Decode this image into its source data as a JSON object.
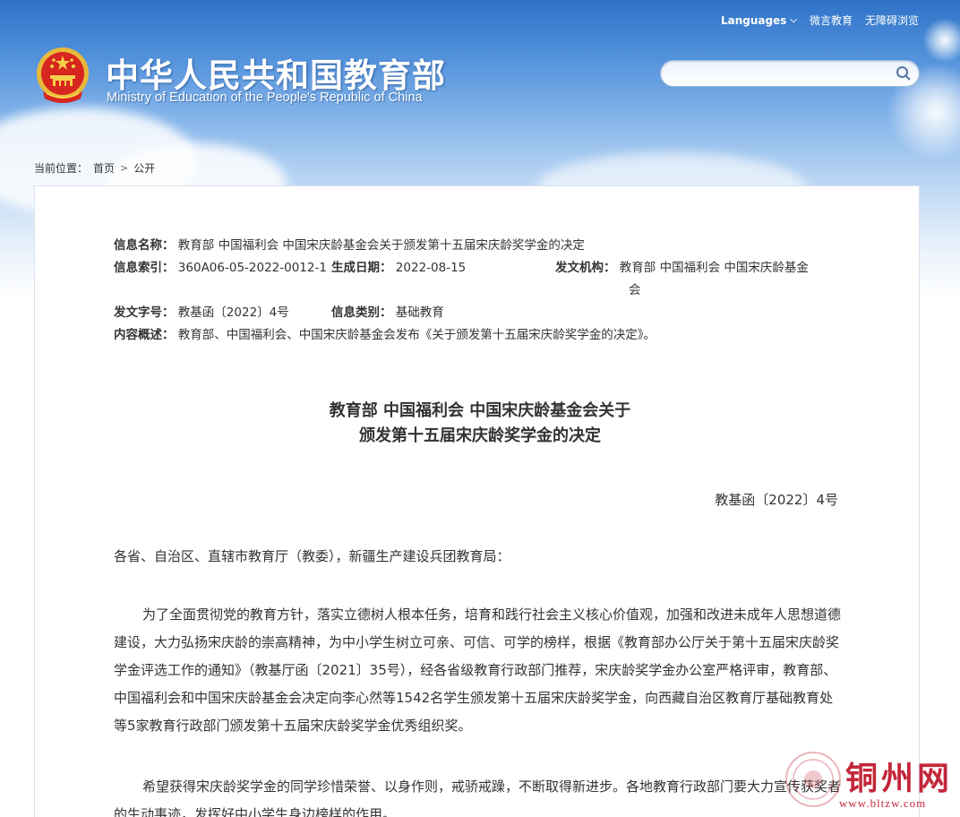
{
  "header": {
    "title_cn": "中华人民共和国教育部",
    "title_en": "Ministry of Education of the People's Republic of China",
    "languages_label": "Languages",
    "links": [
      "微言教育",
      "无障碍浏览"
    ],
    "search": {
      "placeholder": "",
      "value": ""
    }
  },
  "breadcrumb": {
    "prefix": "当前位置：",
    "items": [
      "首页",
      "公开"
    ]
  },
  "meta": {
    "name_label": "信息名称：",
    "name_value": "教育部 中国福利会 中国宋庆龄基金会关于颁发第十五届宋庆龄奖学金的决定",
    "index_label": "信息索引：",
    "index_value": "360A06-05-2022-0012-1",
    "date_label": "生成日期：",
    "date_value": "2022-08-15",
    "issuer_label": "发文机构：",
    "issuer_value_line1": "教育部 中国福利会 中国宋庆龄基金",
    "issuer_value_line2": "会",
    "docnum_label": "发文字号：",
    "docnum_value": "教基函〔2022〕4号",
    "category_label": "信息类别：",
    "category_value": "基础教育",
    "summary_label": "内容概述：",
    "summary_value": "教育部、中国福利会、中国宋庆龄基金会发布《关于颁发第十五届宋庆龄奖学金的决定》。"
  },
  "document": {
    "title_line1": "教育部 中国福利会 中国宋庆龄基金会关于",
    "title_line2": "颁发第十五届宋庆龄奖学金的决定",
    "doc_number": "教基函〔2022〕4号",
    "salutation": "各省、自治区、直辖市教育厅（教委），新疆生产建设兵团教育局：",
    "paragraph1": "为了全面贯彻党的教育方针，落实立德树人根本任务，培育和践行社会主义核心价值观，加强和改进未成年人思想道德建设，大力弘扬宋庆龄的崇高精神，为中小学生树立可亲、可信、可学的榜样，根据《教育部办公厅关于第十五届宋庆龄奖学金评选工作的通知》（教基厅函〔2021〕35号），经各省级教育行政部门推荐，宋庆龄奖学金办公室严格评审，教育部、中国福利会和中国宋庆龄基金会决定向李心然等1542名学生颁发第十五届宋庆龄奖学金，向西藏自治区教育厅基础教育处等5家教育行政部门颁发第十五届宋庆龄奖学金优秀组织奖。",
    "paragraph2": "希望获得宋庆龄奖学金的同学珍惜荣誉、以身作则，戒骄戒躁，不断取得新进步。各地教育行政部门要大力宣传获奖者的生动事迹，发挥好中小学生身边榜样的作用。"
  },
  "watermark": {
    "text": "铜州网",
    "url": "www.bltzw.com"
  },
  "colors": {
    "sky_top": "#2f72c7",
    "watermark_red": "#c3273a"
  }
}
